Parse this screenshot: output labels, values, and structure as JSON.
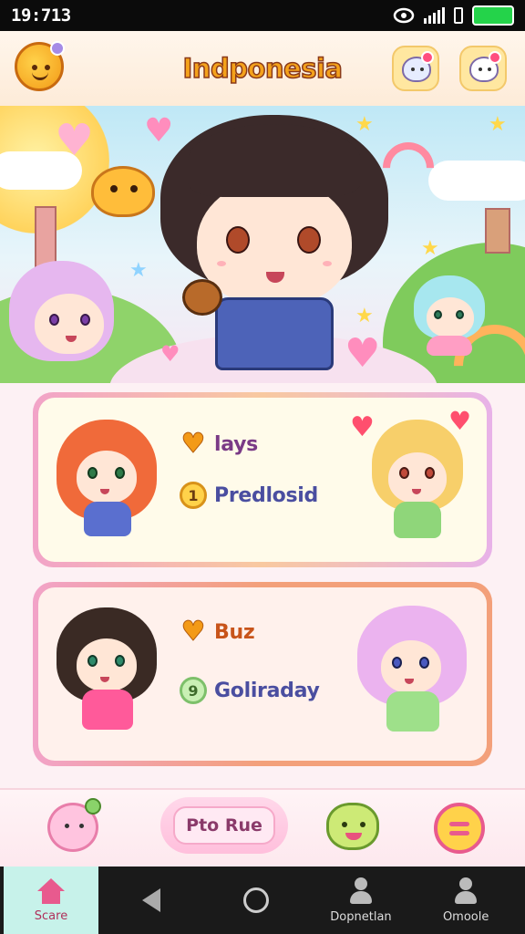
{
  "status_bar": {
    "time": "19:713"
  },
  "header": {
    "title": "Indponesia"
  },
  "cards": [
    {
      "rows": [
        {
          "icon": "heart-icon",
          "label": "lays"
        },
        {
          "icon": "coin-icon",
          "icon_text": "1",
          "label": "Predlosid"
        }
      ]
    },
    {
      "rows": [
        {
          "icon": "heart-icon",
          "label": "Buz"
        },
        {
          "icon": "coin-icon",
          "icon_text": "9",
          "label": "Goliraday"
        }
      ]
    }
  ],
  "action_bar": {
    "pill_label": "Pto Rue"
  },
  "nav": {
    "items": [
      {
        "label": "Scare",
        "icon": "home-icon",
        "active": true
      },
      {
        "label": "",
        "icon": "back-icon"
      },
      {
        "label": "",
        "icon": "home-circle-icon"
      },
      {
        "label": "Dopnetlan",
        "icon": "profile-icon"
      },
      {
        "label": "Omoole",
        "icon": "profile-icon"
      }
    ]
  },
  "colors": {
    "title_fill": "#f4a21b",
    "card1_border": "#f2a3c8",
    "card2_border": "#f3a07a",
    "nav_active": "#c7f2ea"
  }
}
